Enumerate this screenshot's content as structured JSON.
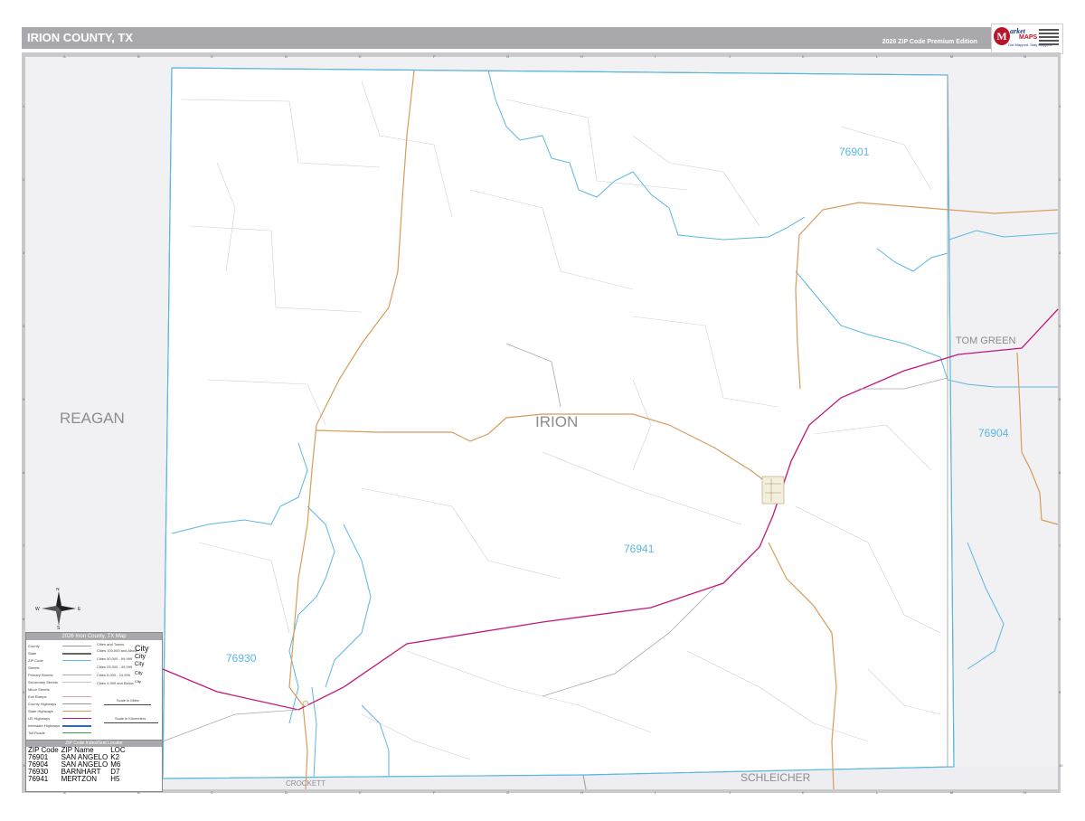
{
  "header": {
    "title": "IRION COUNTY, TX",
    "edition": "2026 ZIP Code Premium Edition"
  },
  "logo": {
    "letter": "M",
    "line1": "arket",
    "line2": "MAPS",
    "tagline": "Get Mapped. Stay Mapped."
  },
  "grid": {
    "columns": [
      "A",
      "B",
      "C",
      "D",
      "E",
      "F",
      "G",
      "H",
      "I",
      "J",
      "K",
      "L",
      "M",
      "N"
    ],
    "rows": [
      "1",
      "2",
      "3",
      "4",
      "5",
      "6",
      "7",
      "8",
      "9",
      "10"
    ]
  },
  "counties": {
    "main": "IRION",
    "west": "REAGAN",
    "east": "TOM GREEN",
    "south_west": "CROCKETT",
    "south_east": "SCHLEICHER"
  },
  "zip_labels": {
    "z76901": "76901",
    "z76904": "76904",
    "z76930": "76930",
    "z76941": "76941"
  },
  "legend": {
    "title": "2026 Irion County, TX Map",
    "items": {
      "county": "County",
      "state": "State",
      "zip": "ZIP Code",
      "streets": "Streets",
      "primary": "Primary Streets",
      "secondary": "Secondary Streets",
      "minor": "Minor Streets",
      "ramps": "Exit Ramps",
      "county_hwy": "County Highways",
      "state_hwy": "State Highways",
      "us_hwy": "US Highways",
      "interstate": "Interstate Highways",
      "toll": "Toll Roads"
    },
    "cities_title": "Cities and Towns",
    "city_tiers": {
      "t1": "Cities 100,000 and Above",
      "t2": "Cities 50,000 - 99,999",
      "t3": "Cities 25,000 - 49,999",
      "t4": "Cities 5,000 - 24,999",
      "t5": "Cities 4,999 and Below"
    },
    "city_samples": {
      "s1": "City",
      "s2": "City",
      "s3": "City",
      "s4": "City",
      "s5": "City"
    },
    "scale_miles": "Scale in Miles",
    "scale_km": "Scale in Kilometers"
  },
  "compass": {
    "n": "N",
    "s": "S",
    "e": "E",
    "w": "W"
  },
  "zip_index": {
    "title": "ZIP Code Index/Grid Locator",
    "headers": [
      "ZIP Code",
      "ZIP Name",
      "LOC"
    ],
    "rows": [
      [
        "76901",
        "SAN ANGELO",
        "K2"
      ],
      [
        "76904",
        "SAN ANGELO",
        "M6"
      ],
      [
        "76930",
        "BARNHART",
        "D7"
      ],
      [
        "76941",
        "MERTZON",
        "H5"
      ]
    ]
  },
  "colors": {
    "zip_boundary": "#5ab7e0",
    "state_highway": "#d89b5a",
    "us_highway": "#c2177a",
    "county_fill": "#ffffff",
    "outside_fill": "#f1f1f4",
    "header_bg": "#a9a9ad"
  }
}
